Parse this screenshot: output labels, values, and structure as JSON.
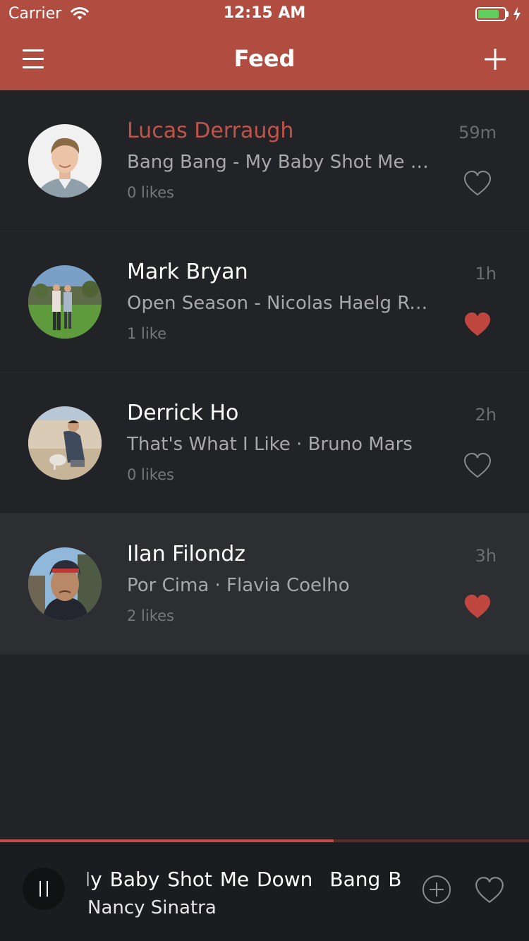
{
  "status_bar": {
    "carrier": "Carrier",
    "time": "12:15 AM",
    "battery_level": 0.8
  },
  "nav": {
    "title": "Feed",
    "menu_icon": "hamburger-menu-icon",
    "add_icon": "plus-icon"
  },
  "feed": [
    {
      "name": "Lucas Derraugh",
      "song": "Bang Bang - My Baby Shot Me Down",
      "likes": "0 likes",
      "time": "59m",
      "liked": false,
      "name_color": "#c0544a"
    },
    {
      "name": "Mark Bryan",
      "song": "Open Season - Nicolas Haelg Remix",
      "likes": "1 like",
      "time": "1h",
      "liked": true,
      "name_color": "#ffffff"
    },
    {
      "name": "Derrick Ho",
      "song": "That's What I Like · Bruno Mars",
      "likes": "0 likes",
      "time": "2h",
      "liked": false,
      "name_color": "#ffffff"
    },
    {
      "name": "Ilan Filondz",
      "song": "Por Cima · Flavia Coelho",
      "likes": "2 likes",
      "time": "3h",
      "liked": true,
      "name_color": "#ffffff",
      "selected": true
    }
  ],
  "player": {
    "progress": 0.63,
    "title_part1": "My Baby Shot Me Down",
    "title_part2": "Bang Bang",
    "artist": "Nancy Sinatra"
  },
  "colors": {
    "accent": "#b14c41",
    "heart_liked": "#c0473f",
    "background": "#222326"
  }
}
